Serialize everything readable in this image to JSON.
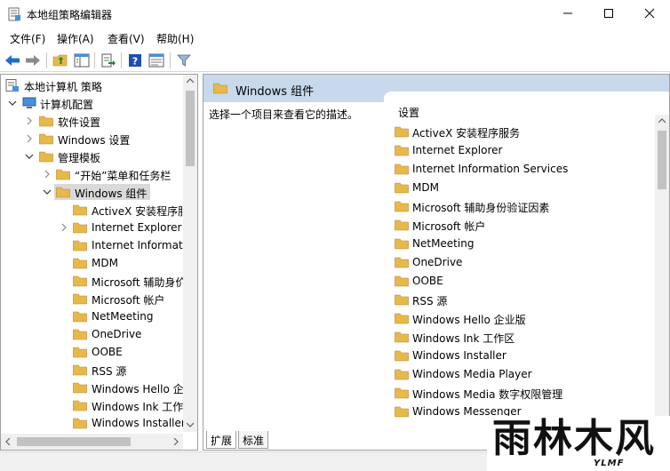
{
  "window": {
    "title": "本地组策略编辑器"
  },
  "menu": {
    "items": [
      {
        "label": "文件(F)"
      },
      {
        "label": "操作(A)"
      },
      {
        "label": "查看(V)"
      },
      {
        "label": "帮助(H)"
      }
    ]
  },
  "toolbar": {
    "icons": [
      "back-arrow-icon",
      "forward-arrow-icon",
      "up-folder-icon",
      "show-hide-tree-icon",
      "export-list-icon",
      "help-icon",
      "properties-icon",
      "filter-icon"
    ]
  },
  "tree": {
    "items": [
      {
        "label": "本地计算机 策略"
      },
      {
        "label": "计算机配置"
      },
      {
        "label": "软件设置"
      },
      {
        "label": "Windows 设置"
      },
      {
        "label": "管理模板"
      },
      {
        "label": "“开始”菜单和任务栏"
      },
      {
        "label": "Windows 组件"
      },
      {
        "label": "ActiveX 安装程序服"
      },
      {
        "label": "Internet Explorer"
      },
      {
        "label": "Internet Informati"
      },
      {
        "label": "MDM"
      },
      {
        "label": "Microsoft 辅助身价"
      },
      {
        "label": "Microsoft 帐户"
      },
      {
        "label": "NetMeeting"
      },
      {
        "label": "OneDrive"
      },
      {
        "label": "OOBE"
      },
      {
        "label": "RSS 源"
      },
      {
        "label": "Windows Hello 企"
      },
      {
        "label": "Windows Ink 工作"
      },
      {
        "label": "Windows Installer"
      }
    ]
  },
  "right_pane": {
    "header_title": "Windows 组件",
    "description": "选择一个项目来查看它的描述。",
    "column_header": "设置",
    "items": [
      {
        "label": "ActiveX 安装程序服务"
      },
      {
        "label": "Internet Explorer"
      },
      {
        "label": "Internet Information Services"
      },
      {
        "label": "MDM"
      },
      {
        "label": "Microsoft 辅助身份验证因素"
      },
      {
        "label": "Microsoft 帐户"
      },
      {
        "label": "NetMeeting"
      },
      {
        "label": "OneDrive"
      },
      {
        "label": "OOBE"
      },
      {
        "label": "RSS 源"
      },
      {
        "label": "Windows Hello 企业版"
      },
      {
        "label": "Windows Ink 工作区"
      },
      {
        "label": "Windows Installer"
      },
      {
        "label": "Windows Media Player"
      },
      {
        "label": "Windows Media 数字权限管理"
      },
      {
        "label": "Windows Messenger"
      }
    ]
  },
  "tabs": [
    {
      "label": "扩展"
    },
    {
      "label": "标准"
    }
  ],
  "watermark": {
    "main": "雨林木风",
    "sub": "YLMF"
  },
  "colors": {
    "folder": "#e8b84a",
    "selection": "#d9d9d9",
    "header_band": "#c8d9ec",
    "accent_blue": "#1e6fc9"
  }
}
